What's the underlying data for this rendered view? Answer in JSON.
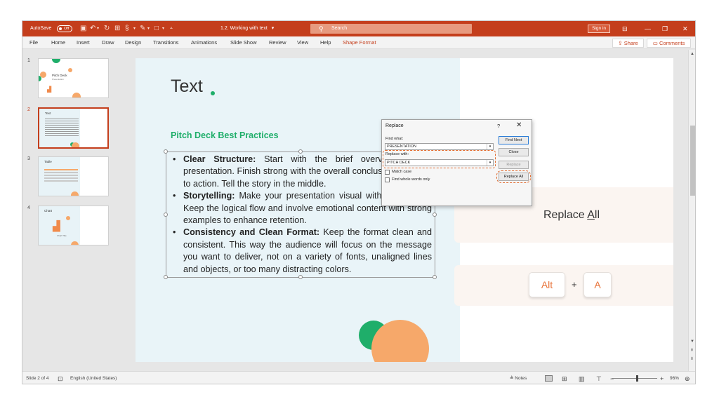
{
  "titlebar": {
    "autosave_label": "AutoSave",
    "autosave_state": "Off",
    "doc_title": "1.2. Working with text",
    "doc_title_caret": "▾",
    "search_placeholder": "Search",
    "signin_label": "Sign in",
    "colors": {
      "accent": "#c43e1c",
      "search_bg": "#e79a7f"
    }
  },
  "menu": {
    "items": [
      "File",
      "Home",
      "Insert",
      "Draw",
      "Design",
      "Transitions",
      "Animations",
      "Slide Show",
      "Review",
      "View",
      "Help",
      "Shape Format"
    ],
    "active": "Shape Format",
    "share_label": "Share",
    "comments_label": "Comments"
  },
  "thumbnails": [
    {
      "number": "1",
      "title": "Pitch Deck",
      "subtitle": "Presentation"
    },
    {
      "number": "2",
      "title": "Text",
      "selected": true
    },
    {
      "number": "3",
      "title": "Table"
    },
    {
      "number": "4",
      "title": "Chart",
      "caption": "Chart Title"
    }
  ],
  "slide": {
    "title": "Text",
    "subtitle": "Pitch Deck Best Practices",
    "bullets": [
      {
        "bold": "Clear Structure:",
        "text": " Start with the brief overview of the presentation. Finish strong with the overall conclusions and call to action. Tell the story in the middle."
      },
      {
        "bold": "Storytelling:",
        "text": " Make your presentation visual with less words. Keep the logical flow and involve emotional content with strong examples to enhance retention."
      },
      {
        "bold": "Consistency and Clean Format:",
        "text": " Keep the format clean and consistent. This way the audience will focus on the message you want to deliver, not on a variety of fonts, unaligned lines and objects, or too many distracting colors."
      }
    ],
    "colors": {
      "green": "#1fae6a",
      "orange": "#f6a86a",
      "panel_blue": "#e9f4f8"
    }
  },
  "callout": {
    "replace_all_prefix": "Replace ",
    "replace_all_underlined": "A",
    "replace_all_suffix": "ll",
    "key1": "Alt",
    "plus": "+",
    "key2": "A"
  },
  "dialog": {
    "title": "Replace",
    "help": "?",
    "close": "✕",
    "find_label": "Find what:",
    "find_value": "PRESENTATION",
    "replace_label": "Replace with:",
    "replace_value": "PITCH DECK",
    "match_case": "Match case",
    "whole_words": "Find whole words only",
    "btn_find_next": "Find Next",
    "btn_close": "Close",
    "btn_replace": "Replace",
    "btn_replace_all": "Replace All"
  },
  "status": {
    "slide_info": "Slide 2 of 4",
    "language": "English (United States)",
    "notes_label": "Notes",
    "zoom_minus": "−",
    "zoom_plus": "+",
    "zoom": "96%"
  }
}
